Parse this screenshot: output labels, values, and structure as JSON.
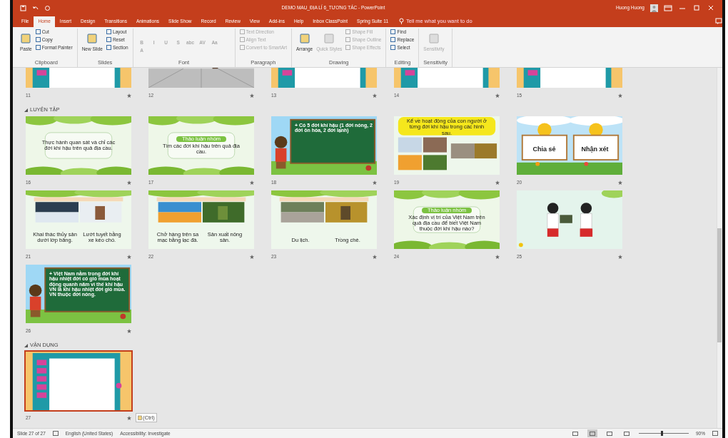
{
  "window": {
    "title": "DEMO MAU_ĐỊA LÍ 6_TƯƠNG TÁC - PowerPoint",
    "user": "Huong Huong"
  },
  "ribbon_tabs": [
    {
      "label": "File",
      "selected": false
    },
    {
      "label": "Home",
      "selected": true
    },
    {
      "label": "Insert",
      "selected": false
    },
    {
      "label": "Design",
      "selected": false
    },
    {
      "label": "Transitions",
      "selected": false
    },
    {
      "label": "Animations",
      "selected": false
    },
    {
      "label": "Slide Show",
      "selected": false
    },
    {
      "label": "Record",
      "selected": false
    },
    {
      "label": "Review",
      "selected": false
    },
    {
      "label": "View",
      "selected": false
    },
    {
      "label": "Add-ins",
      "selected": false
    },
    {
      "label": "Help",
      "selected": false
    },
    {
      "label": "Inbox ClassPoint",
      "selected": false
    },
    {
      "label": "Spring Suite 11",
      "selected": false
    }
  ],
  "tell_me": {
    "placeholder": "Tell me what you want to do"
  },
  "ribbon_groups": [
    {
      "label": "Clipboard",
      "items": [
        {
          "kind": "large",
          "label": "Paste",
          "disabled": false
        },
        {
          "kind": "small",
          "label": "Cut",
          "disabled": false
        },
        {
          "kind": "small",
          "label": "Copy",
          "disabled": false
        },
        {
          "kind": "small",
          "label": "Format Painter",
          "disabled": false
        }
      ]
    },
    {
      "label": "Slides",
      "items": [
        {
          "kind": "large",
          "label": "New Slide",
          "disabled": false
        },
        {
          "kind": "small",
          "label": "Layout",
          "disabled": false
        },
        {
          "kind": "small",
          "label": "Reset",
          "disabled": false
        },
        {
          "kind": "small",
          "label": "Section",
          "disabled": false
        }
      ]
    },
    {
      "label": "Font",
      "items": [
        {
          "kind": "glyph",
          "label": "B",
          "disabled": true
        },
        {
          "kind": "glyph",
          "label": "I",
          "disabled": true
        },
        {
          "kind": "glyph",
          "label": "U",
          "disabled": true
        },
        {
          "kind": "glyph",
          "label": "S",
          "disabled": true
        },
        {
          "kind": "glyph",
          "label": "abc",
          "disabled": true
        },
        {
          "kind": "glyph",
          "label": "AV",
          "disabled": true
        },
        {
          "kind": "glyph",
          "label": "Aa",
          "disabled": true
        },
        {
          "kind": "glyph",
          "label": "A",
          "disabled": true
        }
      ]
    },
    {
      "label": "Paragraph",
      "items": [
        {
          "kind": "small",
          "label": "Text Direction",
          "disabled": true
        },
        {
          "kind": "small",
          "label": "Align Text",
          "disabled": true
        },
        {
          "kind": "small",
          "label": "Convert to SmartArt",
          "disabled": true
        }
      ]
    },
    {
      "label": "Drawing",
      "items": [
        {
          "kind": "large",
          "label": "Arrange",
          "disabled": false
        },
        {
          "kind": "large",
          "label": "Quick Styles",
          "disabled": true
        },
        {
          "kind": "small",
          "label": "Shape Fill",
          "disabled": true
        },
        {
          "kind": "small",
          "label": "Shape Outline",
          "disabled": true
        },
        {
          "kind": "small",
          "label": "Shape Effects",
          "disabled": true
        }
      ]
    },
    {
      "label": "Editing",
      "items": [
        {
          "kind": "small",
          "label": "Find",
          "disabled": false
        },
        {
          "kind": "small",
          "label": "Replace",
          "disabled": false
        },
        {
          "kind": "small",
          "label": "Select",
          "disabled": false
        }
      ]
    },
    {
      "label": "Sensitivity",
      "items": [
        {
          "kind": "large",
          "label": "Sensitivity",
          "disabled": true
        }
      ]
    }
  ],
  "top_slides": [
    {
      "number": "11",
      "kind": "menu"
    },
    {
      "number": "12",
      "kind": "room"
    },
    {
      "number": "13",
      "kind": "menu"
    },
    {
      "number": "14",
      "kind": "menu"
    },
    {
      "number": "15",
      "kind": "menu"
    }
  ],
  "sections": [
    {
      "label": "LUYỆN TẬP",
      "expanded": true,
      "slides": [
        {
          "number": "16",
          "kind": "leafy",
          "selected": false,
          "texts": [
            {
              "kind": "body",
              "text": "Thực hành quan sát và chỉ các đới khí hậu trên quả địa cầu."
            }
          ]
        },
        {
          "number": "17",
          "kind": "leafy",
          "selected": false,
          "texts": [
            {
              "kind": "pill",
              "text": "Thảo luận nhóm"
            },
            {
              "kind": "body",
              "text": "Tìm các đới khí hậu trên quả địa cầu."
            }
          ]
        },
        {
          "number": "18",
          "kind": "chalkboard",
          "selected": false,
          "texts": [
            {
              "kind": "body",
              "text": "+ Có 5 đới khí hậu (1 đới nóng, 2 đới ôn hòa, 2 đới lạnh)"
            }
          ]
        },
        {
          "number": "19",
          "kind": "collage",
          "selected": false,
          "texts": [
            {
              "kind": "body",
              "text": "Kể về hoạt động của con người ở từng đới khí hậu trong các hình sau."
            }
          ]
        },
        {
          "number": "20",
          "kind": "cards",
          "selected": false,
          "texts": [
            {
              "kind": "body",
              "text": "Chia sẻ"
            },
            {
              "kind": "body",
              "text": "Nhận xét"
            }
          ]
        },
        {
          "number": "21",
          "kind": "snow",
          "selected": false,
          "texts": [
            {
              "kind": "body",
              "text": "Khai thác thủy sản dưới lớp băng."
            },
            {
              "kind": "body",
              "text": "Lướt tuyết bằng xe kéo chó."
            }
          ]
        },
        {
          "number": "22",
          "kind": "desert",
          "selected": false,
          "texts": [
            {
              "kind": "body",
              "text": "Chở hàng trên sa mạc bằng lạc đà."
            },
            {
              "kind": "body",
              "text": "Sản xuất nông sản."
            }
          ]
        },
        {
          "number": "23",
          "kind": "city",
          "selected": false,
          "texts": [
            {
              "kind": "body",
              "text": "Du lịch."
            },
            {
              "kind": "body",
              "text": "Trồng chè."
            }
          ]
        },
        {
          "number": "24",
          "kind": "leafy",
          "selected": false,
          "texts": [
            {
              "kind": "pill",
              "text": "Thảo luận nhóm"
            },
            {
              "kind": "body",
              "text": "Xác định vị trí của Việt Nam trên quả địa cầu để biết Việt Nam thuộc đới khí hậu nào?"
            }
          ]
        },
        {
          "number": "25",
          "kind": "kids",
          "selected": false
        },
        {
          "number": "26",
          "kind": "chalkboard",
          "selected": false,
          "texts": [
            {
              "kind": "body",
              "text": "+ Việt Nam nằm trong đới khí hậu nhiệt đới có gió mùa hoạt động quanh năm vì thế khí hậu VN là khí hậu nhiệt đới gió mùa. VN thuộc đới nóng."
            }
          ]
        }
      ]
    },
    {
      "label": "VẬN DỤNG",
      "expanded": true,
      "slides": [
        {
          "number": "27",
          "kind": "menu",
          "selected": true
        }
      ]
    }
  ],
  "paste_tag": "(Ctrl)",
  "status_bar": {
    "slide": "Slide 27 of 27",
    "language": "English (United States)",
    "accessibility": "Accessibility: Investigate",
    "views": [
      {
        "selected": false
      },
      {
        "selected": true
      },
      {
        "selected": false
      },
      {
        "selected": false
      }
    ],
    "zoom": {
      "level": 0.45,
      "reading": "90%"
    }
  }
}
